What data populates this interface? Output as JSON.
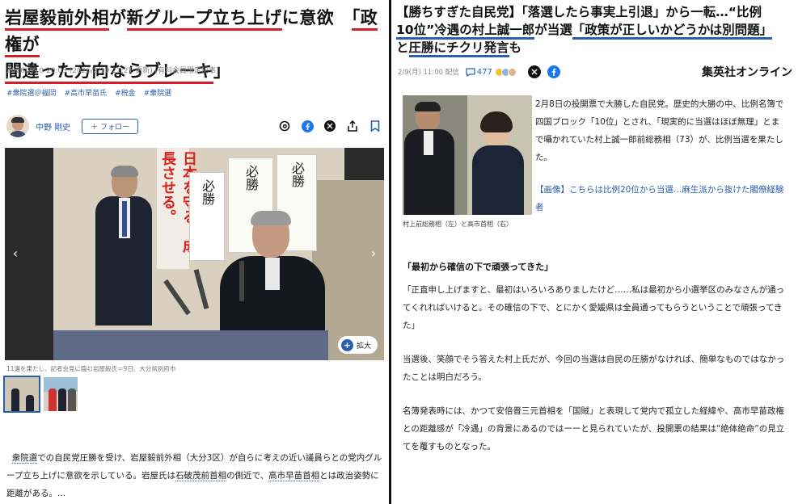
{
  "left": {
    "title_parts": [
      "岩屋毅前外相",
      "が",
      "新グループ立ち上げ",
      "に意欲　",
      "「政権が",
      "間違った方向ならブレーキ",
      "」"
    ],
    "meta": "2026/2/10 20:03 (2026/2/10 21:21 更新) [有料会員限定記事]",
    "tags": [
      "#衆院選＠福岡",
      "#高市早苗氏",
      "#税金",
      "#衆院選"
    ],
    "author": {
      "name": "中野 剛史",
      "follow_label": "＋ フォロー"
    },
    "share_icons": [
      "threads-icon",
      "facebook-icon",
      "x-icon",
      "share-icon",
      "bookmark-icon"
    ],
    "photo": {
      "poster_text": "日本を守る。成長させる。",
      "calligraphy": [
        "必勝",
        "必勝",
        "必勝"
      ],
      "expand_label": "拡大"
    },
    "caption": "11選を果たし、記者会見に臨む岩屋毅氏＝9日、大分県別府市",
    "body": {
      "t1": "衆院選",
      "t2": "での自民党圧勝を受け、岩屋毅前外相（大分3区）が自らに考えの近い議員らとの党内グループ立ち上げに意欲を示している。岩屋氏は",
      "t3": "石破茂前首相",
      "t4": "の側近で、",
      "t5": "高市早苗首相",
      "t6": "とは政治姿勢に距離がある。..."
    }
  },
  "right": {
    "title": {
      "p1": "【勝ちすぎた自民党】「落選したら事実上引退」から一転…“比例",
      "p2": "10位”冷遇の村上誠一郎",
      "p3": "が当選",
      "p4": "「政策が正しいかどうかは別問題」",
      "p5": "と",
      "p6": "圧勝にチクリ発言",
      "p7": "も"
    },
    "meta": {
      "date": "2/9(月) 11:00 配信",
      "comments": "477",
      "publisher": "集英社オンライン"
    },
    "photo_caption": "村上前総務相（左）と高市首相（右）",
    "lead": "2月8日の投開票で大勝した自民党。歴史的大勝の中、比例名簿で四国ブロック「10位」とされ、「現実的に当選はほぼ無理」とまで囁かれていた村上誠一郎前総務相（73）が、比例当選を果たした。",
    "link": "【画像】こちらは比例20位から当選…麻生派から抜けた閣僚経験者",
    "heading": "「最初から確信の下で頑張ってきた」",
    "paragraphs": [
      "「正直申し上げますと、最初はいろいろありましたけど……私は最初から小選挙区のみなさんが通ってくれればいけると。その確信の下で、とにかく愛媛県は全員通ってもらうということで頑張ってきた」",
      "当選後、笑顔でそう答えた村上氏だが、今回の当選は自民の圧勝がなければ、簡単なものではなかったことは明白だろう。",
      "名簿発表時には、かつて安倍晋三元首相を「国賊」と表現して党内で孤立した経緯や、高市早苗政権との距離感が「冷遇」の背景にあるのではーーと見られていたが、投開票の結果は“絶体絶命”の見立てを覆すものとなった。"
    ]
  },
  "colors": {
    "accent_red": "#d21f2b",
    "accent_blue": "#2a5fb0"
  }
}
